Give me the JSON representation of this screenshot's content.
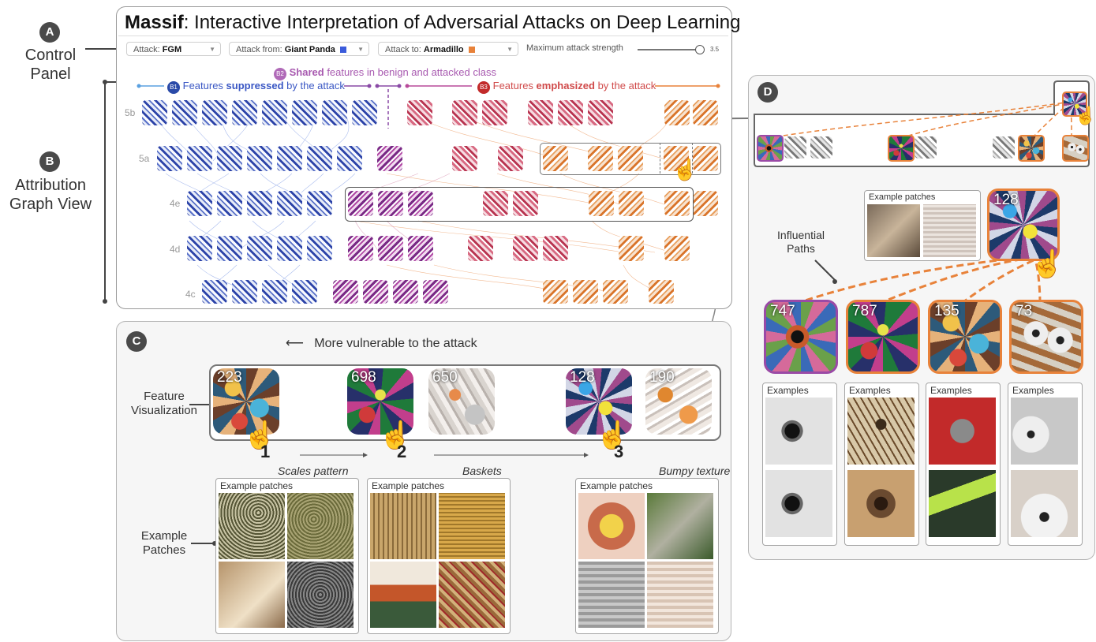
{
  "figure_labels": {
    "a": "A",
    "b": "B",
    "c": "C",
    "d": "D",
    "control_panel": "Control Panel",
    "attribution_graph_view": "Attribution Graph View"
  },
  "app": {
    "title_bold": "Massif",
    "title_rest": ": Interactive Interpretation of Adversarial Attacks on Deep Learning"
  },
  "controls": {
    "attack_label": "Attack:",
    "attack_value": "FGM",
    "from_label": "Attack from:",
    "from_value": "Giant Panda",
    "from_color": "#3b5bdb",
    "to_label": "Attack to:",
    "to_value": "Armadillo",
    "to_color": "#e8823a",
    "strength_label": "Maximum attack strength",
    "strength_value": "3.5"
  },
  "graph": {
    "b1_badge": "B1",
    "b1_pre": "Features ",
    "b1_bold": "suppressed",
    "b1_post": " by the attack",
    "b2_badge": "B2",
    "b2_bold": "Shared",
    "b2_post": " features in benign and attacked class",
    "b3_badge": "B3",
    "b3_pre": "Features ",
    "b3_bold": "emphasized",
    "b3_post": " by the attack",
    "rows": [
      "5b",
      "5a",
      "4e",
      "4d",
      "4c"
    ],
    "colors": {
      "blue": "#3a57c4",
      "purple": "#9a4aa6",
      "red": "#d04a5a",
      "orange": "#e8823a"
    }
  },
  "panel_c": {
    "vulnerable": "More vulnerable to the attack",
    "feature_vis_label": "Feature Visualization",
    "features": [
      "223",
      "698",
      "650",
      "128",
      "190"
    ],
    "clicks": [
      "1",
      "2",
      "3"
    ],
    "captions": [
      "Scales pattern",
      "Baskets",
      "Bumpy texture"
    ],
    "example_patches_label": "Example Patches",
    "example_patches_title": "Example patches"
  },
  "panel_d": {
    "main_feature": "128",
    "example_patches_title": "Example patches",
    "influential_paths": "Influential Paths",
    "paths": [
      "747",
      "787",
      "135",
      "73"
    ],
    "examples_title": "Examples"
  }
}
